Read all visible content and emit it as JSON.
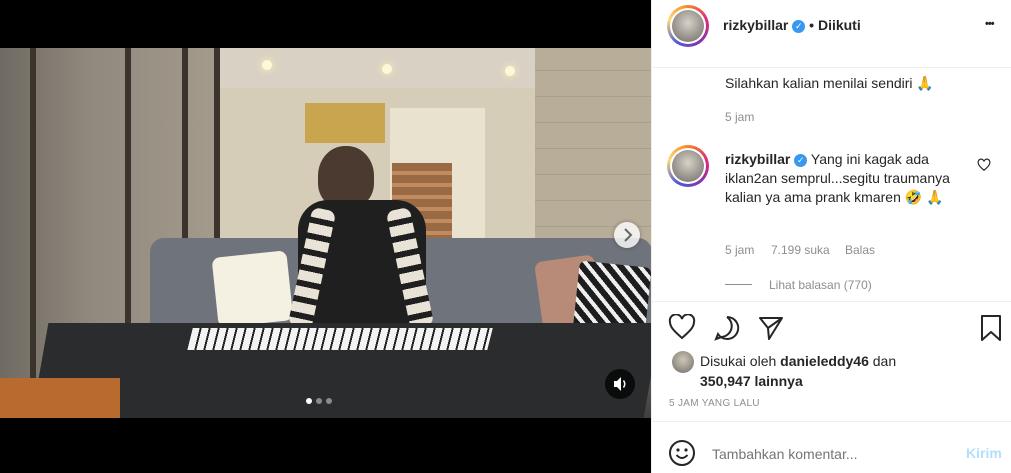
{
  "header": {
    "username": "rizkybillar",
    "separator": "•",
    "follow_status": "Diikuti",
    "more": "•••"
  },
  "caption": {
    "text": "Silahkan kalian menilai sendiri 🙏",
    "time": "5 jam"
  },
  "comment": {
    "username": "rizkybillar",
    "text": "Yang ini kagak ada iklan2an semprul...segitu traumanya kalian ya ama prank kmaren 🤣 🙏",
    "time": "5 jam",
    "likes": "7.199 suka",
    "reply": "Balas",
    "view_replies": "Lihat balasan (770)"
  },
  "likes": {
    "prefix": "Disukai oleh",
    "liker": "danieleddy46",
    "and": "dan",
    "others": "350,947 lainnya"
  },
  "timestamp": "5 JAM YANG LALU",
  "composer": {
    "placeholder": "Tambahkan komentar...",
    "submit": "Kirim"
  },
  "carousel": {
    "count": 3,
    "active": 0
  },
  "colors": {
    "accent": "#3897f0",
    "submit_disabled": "#b2dffc"
  }
}
